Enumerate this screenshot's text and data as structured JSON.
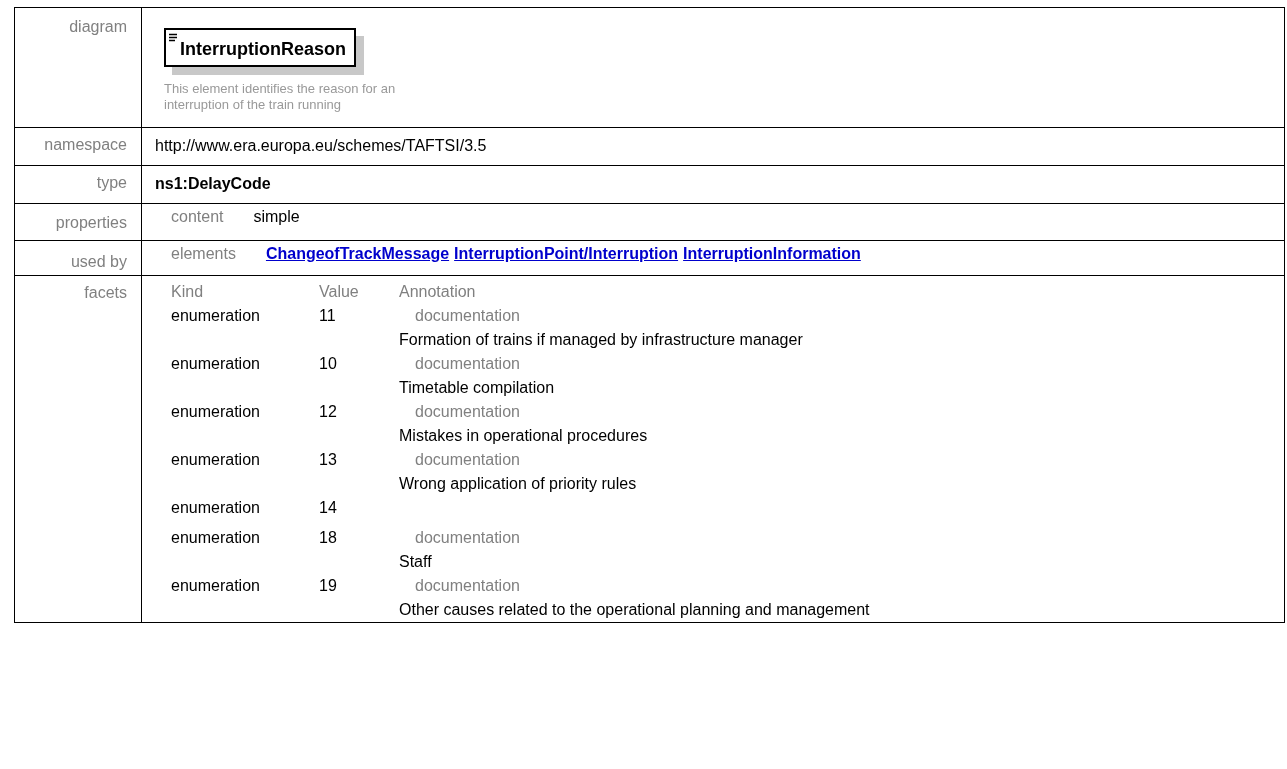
{
  "diagram": {
    "label": "diagram",
    "element_name": "InterruptionReason",
    "description": "This element identifies the reason for an interruption of the train running"
  },
  "rows": [
    {
      "label": "namespace",
      "kind": "text",
      "value": "http://www.era.europa.eu/schemes/TAFTSI/3.5"
    },
    {
      "label": "type",
      "kind": "bold",
      "value": "ns1:DelayCode"
    },
    {
      "label": "properties",
      "kind": "pair",
      "key": "content",
      "value": "simple"
    },
    {
      "label": "used by",
      "kind": "links",
      "key": "elements",
      "links": [
        "ChangeofTrackMessage",
        "InterruptionPoint/Interruption",
        "InterruptionInformation"
      ]
    }
  ],
  "facets": {
    "label": "facets",
    "columns": [
      "Kind",
      "Value",
      "Annotation"
    ],
    "rows": [
      {
        "kind": "enumeration",
        "value": "11",
        "annotation_label": "documentation",
        "annotation": "Formation of trains if managed by infrastructure manager"
      },
      {
        "kind": "enumeration",
        "value": "10",
        "annotation_label": "documentation",
        "annotation": "Timetable compilation"
      },
      {
        "kind": "enumeration",
        "value": "12",
        "annotation_label": "documentation",
        "annotation": "Mistakes in operational procedures"
      },
      {
        "kind": "enumeration",
        "value": "13",
        "annotation_label": "documentation",
        "annotation": "Wrong application of priority rules"
      },
      {
        "kind": "enumeration",
        "value": "14"
      },
      {
        "kind": "enumeration",
        "value": "18",
        "annotation_label": "documentation",
        "annotation": "Staff"
      },
      {
        "kind": "enumeration",
        "value": "19",
        "annotation_label": "documentation",
        "annotation": "Other causes related to the operational planning and management"
      }
    ]
  }
}
